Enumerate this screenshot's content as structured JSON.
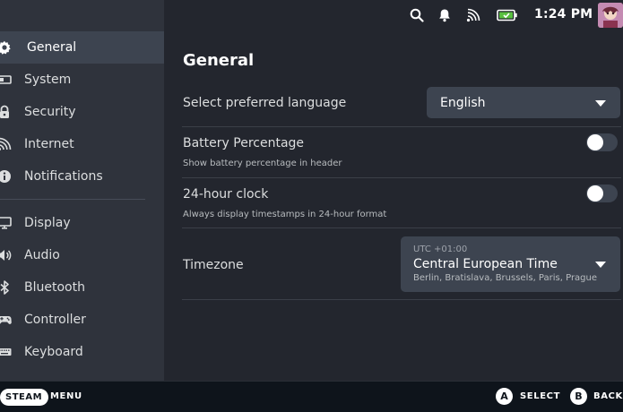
{
  "topbar": {
    "icons": [
      "search-icon",
      "notifications-bell-icon",
      "wifi-icon",
      "battery-charging-icon"
    ],
    "time": "1:24 PM"
  },
  "sidebar": {
    "items": [
      {
        "label": "General",
        "icon": "gear-icon",
        "active": true
      },
      {
        "label": "System",
        "icon": "system-icon"
      },
      {
        "label": "Security",
        "icon": "lock-icon"
      },
      {
        "label": "Internet",
        "icon": "wifi-icon"
      },
      {
        "label": "Notifications",
        "icon": "info-icon"
      },
      {
        "label": "Display",
        "icon": "monitor-icon"
      },
      {
        "label": "Audio",
        "icon": "speaker-icon"
      },
      {
        "label": "Bluetooth",
        "icon": "bluetooth-icon"
      },
      {
        "label": "Controller",
        "icon": "gamepad-icon"
      },
      {
        "label": "Keyboard",
        "icon": "keyboard-icon"
      }
    ]
  },
  "main": {
    "title": "General",
    "language": {
      "label": "Select preferred language",
      "value": "English"
    },
    "battery_percentage": {
      "label": "Battery Percentage",
      "description": "Show battery percentage in header",
      "enabled": false
    },
    "clock_24h": {
      "label": "24-hour clock",
      "description": "Always display timestamps in 24-hour format",
      "enabled": false
    },
    "timezone": {
      "label": "Timezone",
      "offset": "UTC +01:00",
      "name": "Central European Time",
      "cities": "Berlin, Bratislava, Brussels, Paris, Prague"
    }
  },
  "footer": {
    "steam": "STEAM",
    "menu": "MENU",
    "a_glyph": "A",
    "select": "SELECT",
    "b_glyph": "B",
    "back": "BACK"
  }
}
